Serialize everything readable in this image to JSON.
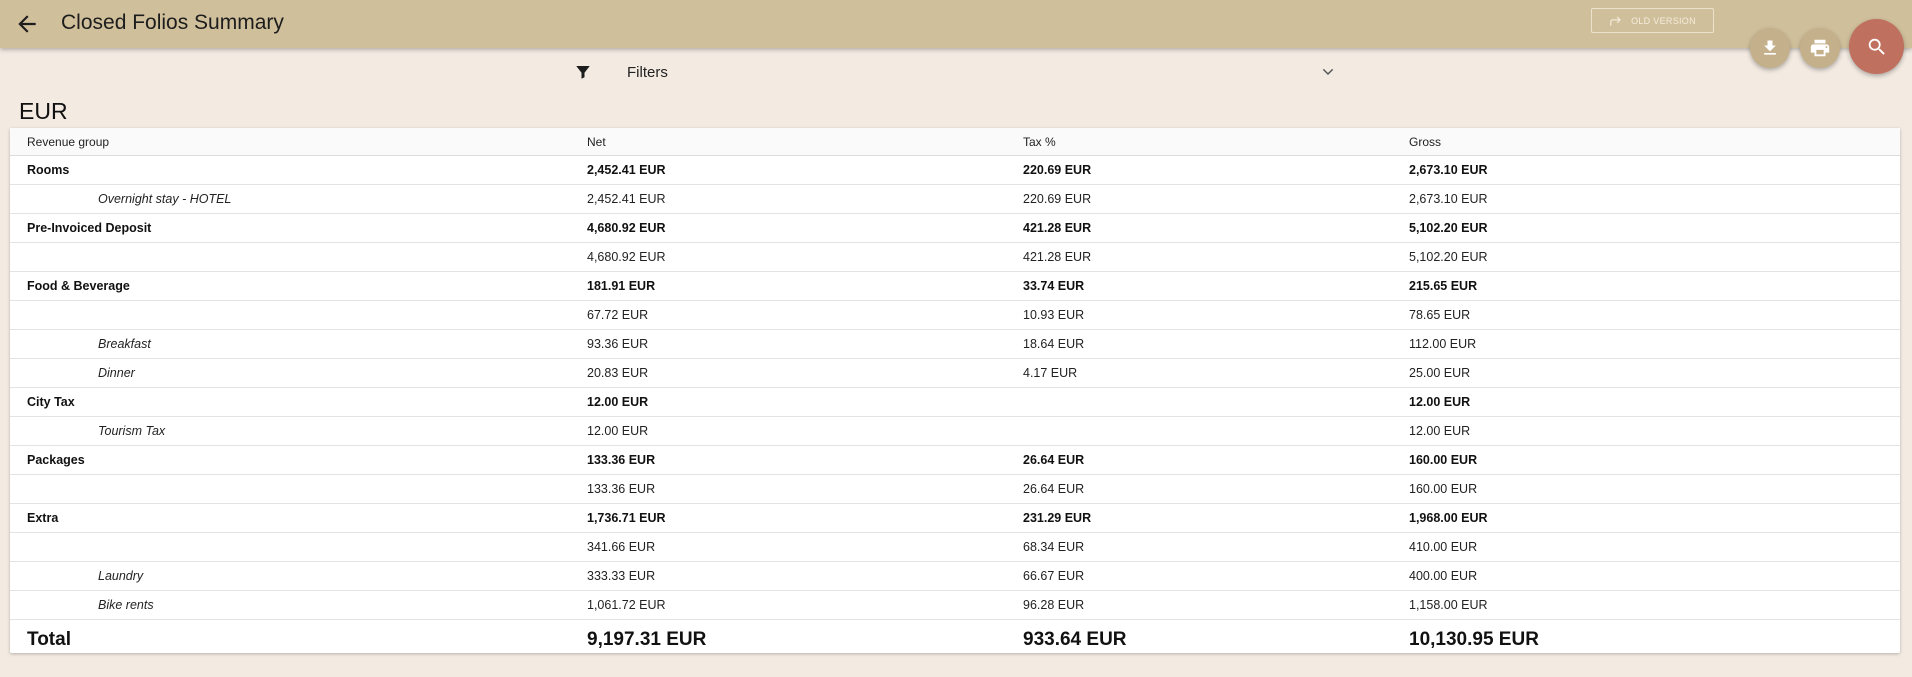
{
  "header": {
    "title": "Closed Folios Summary",
    "old_version_label": "OLD VERSION"
  },
  "filters": {
    "label": "Filters"
  },
  "currency": "EUR",
  "table": {
    "columns": {
      "group": "Revenue group",
      "net": "Net",
      "tax": "Tax %",
      "gross": "Gross"
    },
    "rows": [
      {
        "type": "group",
        "name": "Rooms",
        "net": "2,452.41 EUR",
        "tax": "220.69 EUR",
        "gross": "2,673.10 EUR"
      },
      {
        "type": "sub",
        "name": "Overnight stay - HOTEL",
        "net": "2,452.41 EUR",
        "tax": "220.69 EUR",
        "gross": "2,673.10 EUR"
      },
      {
        "type": "group",
        "name": "Pre-Invoiced Deposit",
        "net": "4,680.92 EUR",
        "tax": "421.28 EUR",
        "gross": "5,102.20 EUR"
      },
      {
        "type": "sub",
        "name": "",
        "net": "4,680.92 EUR",
        "tax": "421.28 EUR",
        "gross": "5,102.20 EUR"
      },
      {
        "type": "group",
        "name": "Food & Beverage",
        "net": "181.91 EUR",
        "tax": "33.74 EUR",
        "gross": "215.65 EUR"
      },
      {
        "type": "sub",
        "name": "",
        "net": "67.72 EUR",
        "tax": "10.93 EUR",
        "gross": "78.65 EUR"
      },
      {
        "type": "sub",
        "name": "Breakfast",
        "net": "93.36 EUR",
        "tax": "18.64 EUR",
        "gross": "112.00 EUR"
      },
      {
        "type": "sub",
        "name": "Dinner",
        "net": "20.83 EUR",
        "tax": "4.17 EUR",
        "gross": "25.00 EUR"
      },
      {
        "type": "group",
        "name": "City Tax",
        "net": "12.00 EUR",
        "tax": "",
        "gross": "12.00 EUR"
      },
      {
        "type": "sub",
        "name": "Tourism Tax",
        "net": "12.00 EUR",
        "tax": "",
        "gross": "12.00 EUR"
      },
      {
        "type": "group",
        "name": "Packages",
        "net": "133.36 EUR",
        "tax": "26.64 EUR",
        "gross": "160.00 EUR"
      },
      {
        "type": "sub",
        "name": "",
        "net": "133.36 EUR",
        "tax": "26.64 EUR",
        "gross": "160.00 EUR"
      },
      {
        "type": "group",
        "name": "Extra",
        "net": "1,736.71 EUR",
        "tax": "231.29 EUR",
        "gross": "1,968.00 EUR"
      },
      {
        "type": "sub",
        "name": "",
        "net": "341.66 EUR",
        "tax": "68.34 EUR",
        "gross": "410.00 EUR"
      },
      {
        "type": "sub",
        "name": "Laundry",
        "net": "333.33 EUR",
        "tax": "66.67 EUR",
        "gross": "400.00 EUR"
      },
      {
        "type": "sub",
        "name": "Bike rents",
        "net": "1,061.72 EUR",
        "tax": "96.28 EUR",
        "gross": "1,158.00 EUR"
      }
    ],
    "total": {
      "label": "Total",
      "net": "9,197.31 EUR",
      "tax": "933.64 EUR",
      "gross": "10,130.95 EUR"
    }
  },
  "icons": {
    "back": "arrow-back-icon",
    "old_version": "redo-arrow-icon",
    "download": "download-icon",
    "print": "print-icon",
    "search": "search-icon",
    "filter": "filter-funnel-icon",
    "chevron": "chevron-down-icon"
  },
  "colors": {
    "app_bar": "#d0bf9b",
    "background": "#f3ebe2",
    "search_fab": "#c0705e",
    "small_fab": "#c4b08b"
  }
}
